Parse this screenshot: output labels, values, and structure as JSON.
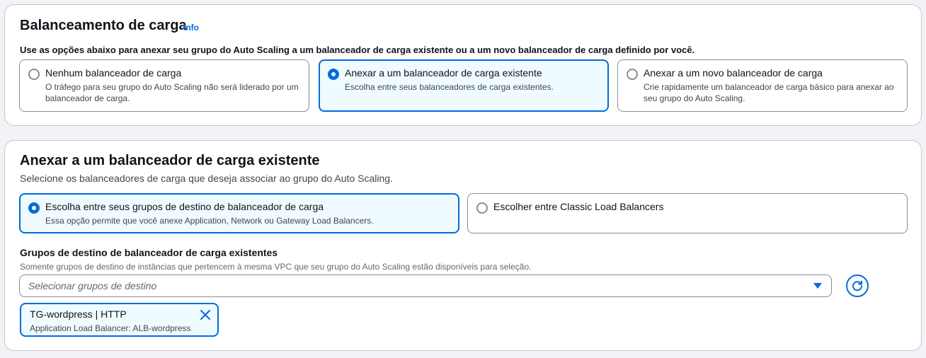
{
  "colors": {
    "accent": "#006ce0",
    "selected_bg": "#f0fbff",
    "border": "#8c8c94",
    "text": "#0f141a",
    "muted": "#424650"
  },
  "load_balancing": {
    "title": "Balanceamento de carga",
    "info_link": "Info",
    "description": "Use as opções abaixo para anexar seu grupo do Auto Scaling a um balanceador de carga existente ou a um novo balanceador de carga definido por você.",
    "options": [
      {
        "label": "Nenhum balanceador de carga",
        "description": "O tráfego para seu grupo do Auto Scaling não será liderado por um balanceador de carga.",
        "selected": false
      },
      {
        "label": "Anexar a um balanceador de carga existente",
        "description": "Escolha entre seus balanceadores de carga existentes.",
        "selected": true
      },
      {
        "label": "Anexar a um novo balanceador de carga",
        "description": "Crie rapidamente um balanceador de carga básico para anexar ao seu grupo do Auto Scaling.",
        "selected": false
      }
    ]
  },
  "attach_existing": {
    "title": "Anexar a um balanceador de carga existente",
    "description": "Selecione os balanceadores de carga que deseja associar ao grupo do Auto Scaling.",
    "options": [
      {
        "label": "Escolha entre seus grupos de destino de balanceador de carga",
        "description": "Essa opção permite que você anexe Application, Network ou Gateway Load Balancers.",
        "selected": true
      },
      {
        "label": "Escolher entre Classic Load Balancers",
        "description": "",
        "selected": false
      }
    ],
    "target_groups": {
      "label": "Grupos de destino de balanceador de carga existentes",
      "description": "Somente grupos de destino de instâncias que pertencem à mesma VPC que seu grupo do Auto Scaling estão disponíveis para seleção.",
      "placeholder": "Selecionar grupos de destino",
      "refresh_icon": "refresh-icon",
      "tokens": [
        {
          "label": "TG-wordpress | HTTP",
          "description": "Application Load Balancer: ALB-wordpress",
          "dismiss_icon": "close-icon"
        }
      ]
    }
  }
}
